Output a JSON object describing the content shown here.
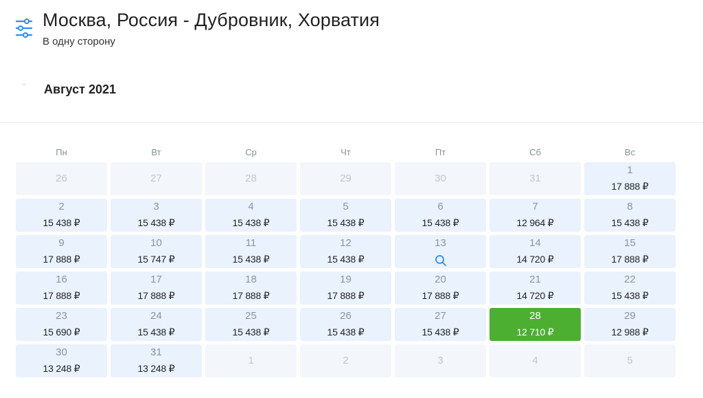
{
  "header": {
    "title": "Москва, Россия - Дубровник, Хорватия",
    "subtitle": "В одну сторону",
    "filter_icon": "filter-sliders-icon"
  },
  "month": "Август 2021",
  "weekdays": [
    "Пн",
    "Вт",
    "Ср",
    "Чт",
    "Пт",
    "Сб",
    "Вс"
  ],
  "colors": {
    "accent": "#2a8cf5",
    "best": "#4caf32",
    "cell": "#e9f2fd",
    "cell_muted": "#f3f6fa"
  },
  "weeks": [
    [
      {
        "day": "26",
        "price": ""
      },
      {
        "day": "27",
        "price": ""
      },
      {
        "day": "28",
        "price": ""
      },
      {
        "day": "29",
        "price": ""
      },
      {
        "day": "30",
        "price": ""
      },
      {
        "day": "31",
        "price": ""
      },
      {
        "day": "1",
        "price": "17 888 ₽"
      }
    ],
    [
      {
        "day": "2",
        "price": "15 438 ₽"
      },
      {
        "day": "3",
        "price": "15 438 ₽"
      },
      {
        "day": "4",
        "price": "15 438 ₽"
      },
      {
        "day": "5",
        "price": "15 438 ₽"
      },
      {
        "day": "6",
        "price": "15 438 ₽"
      },
      {
        "day": "7",
        "price": "12 964 ₽"
      },
      {
        "day": "8",
        "price": "15 438 ₽"
      }
    ],
    [
      {
        "day": "9",
        "price": "17 888 ₽"
      },
      {
        "day": "10",
        "price": "15 747 ₽"
      },
      {
        "day": "11",
        "price": "15 438 ₽"
      },
      {
        "day": "12",
        "price": "15 438 ₽"
      },
      {
        "day": "13",
        "price": "",
        "icon": "search-icon"
      },
      {
        "day": "14",
        "price": "14 720 ₽"
      },
      {
        "day": "15",
        "price": "17 888 ₽"
      }
    ],
    [
      {
        "day": "16",
        "price": "17 888 ₽"
      },
      {
        "day": "17",
        "price": "17 888 ₽"
      },
      {
        "day": "18",
        "price": "17 888 ₽"
      },
      {
        "day": "19",
        "price": "17 888 ₽"
      },
      {
        "day": "20",
        "price": "17 888 ₽"
      },
      {
        "day": "21",
        "price": "14 720 ₽"
      },
      {
        "day": "22",
        "price": "15 438 ₽"
      }
    ],
    [
      {
        "day": "23",
        "price": "15 690 ₽"
      },
      {
        "day": "24",
        "price": "15 438 ₽"
      },
      {
        "day": "25",
        "price": "15 438 ₽"
      },
      {
        "day": "26",
        "price": "15 438 ₽"
      },
      {
        "day": "27",
        "price": "15 438 ₽"
      },
      {
        "day": "28",
        "price": "12 710 ₽",
        "best": true
      },
      {
        "day": "29",
        "price": "12 988 ₽"
      }
    ],
    [
      {
        "day": "30",
        "price": "13 248 ₽"
      },
      {
        "day": "31",
        "price": "13 248 ₽"
      },
      {
        "day": "1",
        "price": ""
      },
      {
        "day": "2",
        "price": ""
      },
      {
        "day": "3",
        "price": ""
      },
      {
        "day": "4",
        "price": ""
      },
      {
        "day": "5",
        "price": ""
      }
    ]
  ]
}
